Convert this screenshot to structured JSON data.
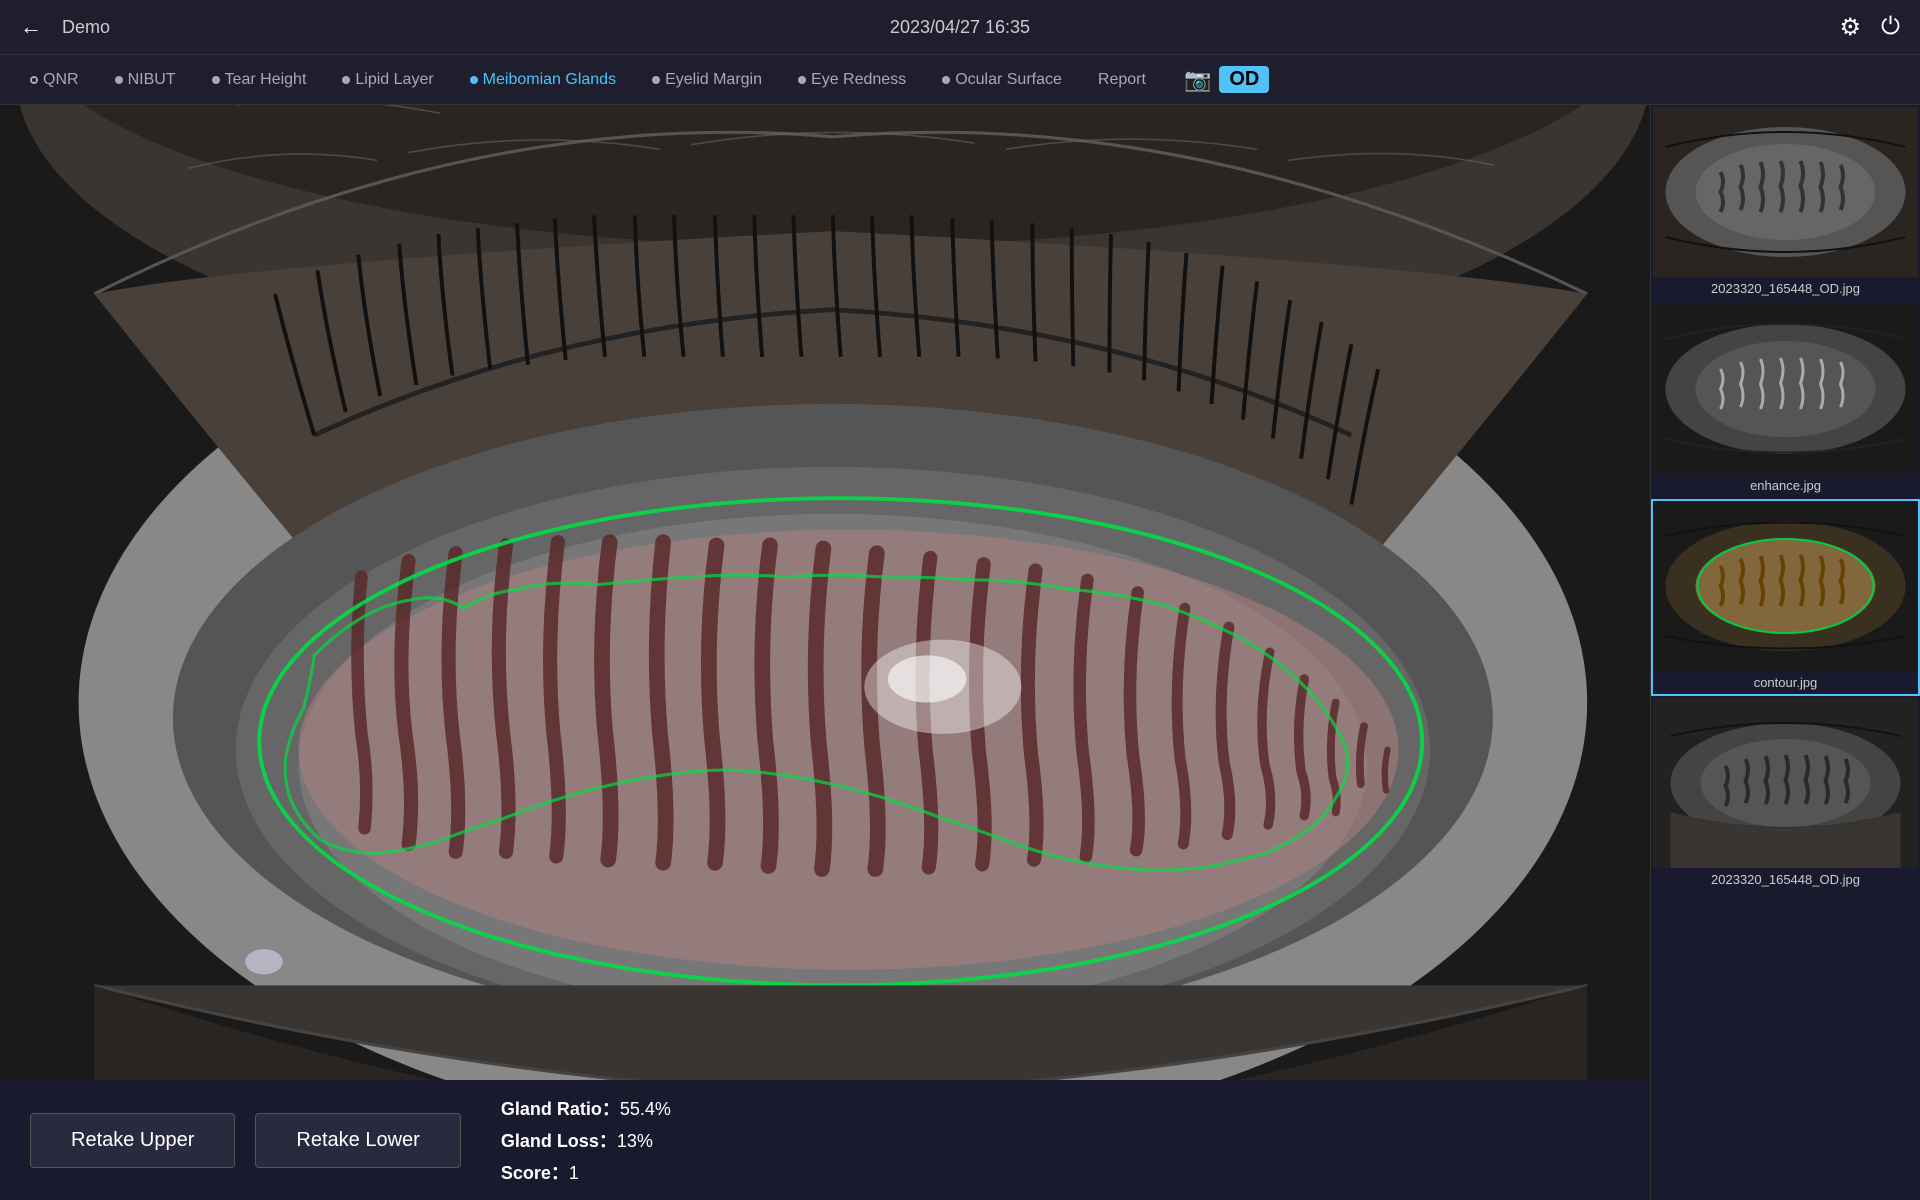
{
  "header": {
    "back_label": "←",
    "demo_label": "Demo",
    "datetime": "2023/04/27 16:35",
    "gear_icon": "⚙",
    "power_icon": "⏻"
  },
  "nav": {
    "items": [
      {
        "id": "qnr",
        "label": "QNR",
        "dot": "empty",
        "active": false
      },
      {
        "id": "nibut",
        "label": "NIBUT",
        "dot": "filled",
        "active": false
      },
      {
        "id": "tear-height",
        "label": "Tear Height",
        "dot": "filled",
        "active": false
      },
      {
        "id": "lipid-layer",
        "label": "Lipid Layer",
        "dot": "filled",
        "active": false
      },
      {
        "id": "meibomian-glands",
        "label": "Meibomian Glands",
        "dot": "filled",
        "active": true
      },
      {
        "id": "eyelid-margin",
        "label": "Eyelid Margin",
        "dot": "filled",
        "active": false
      },
      {
        "id": "eye-redness",
        "label": "Eye Redness",
        "dot": "filled",
        "active": false
      },
      {
        "id": "ocular-surface",
        "label": "Ocular Surface",
        "dot": "filled",
        "active": false
      },
      {
        "id": "report",
        "label": "Report",
        "dot": "none",
        "active": false
      }
    ],
    "camera_icon": "📷",
    "od_label": "OD"
  },
  "main": {
    "image_alt": "Meibomian glands eye scan with green contour overlay"
  },
  "controls": {
    "retake_upper_label": "Retake Upper",
    "retake_lower_label": "Retake Lower",
    "gland_ratio_label": "Gland Ratio：",
    "gland_ratio_value": "55.4%",
    "gland_loss_label": "Gland Loss：",
    "gland_loss_value": "13%",
    "score_label": "Score：",
    "score_value": "1"
  },
  "thumbnails": [
    {
      "id": "thumb1",
      "filename": "2023320_165448_OD.jpg",
      "selected": false,
      "style": "gray"
    },
    {
      "id": "thumb2",
      "filename": "enhance.jpg",
      "selected": false,
      "style": "enhance"
    },
    {
      "id": "thumb3",
      "filename": "contour.jpg",
      "selected": true,
      "style": "contour"
    },
    {
      "id": "thumb4",
      "filename": "2023320_165448_OD.jpg",
      "selected": false,
      "style": "bottom"
    }
  ],
  "colors": {
    "accent": "#4fc3f7",
    "background": "#1a1a2e",
    "header_bg": "#1e1e2e",
    "active_tab": "#4fc3f7",
    "gland_overlay": "rgba(200,150,150,0.35)",
    "gland_border": "#00cc44"
  }
}
